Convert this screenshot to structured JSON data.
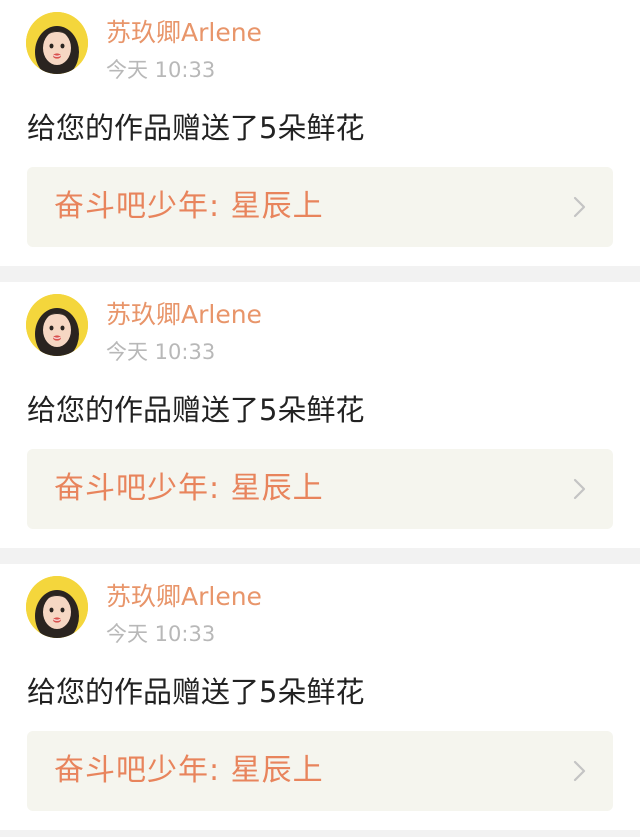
{
  "notifications": [
    {
      "username": "苏玖卿Arlene",
      "timestamp": "今天 10:33",
      "message": "给您的作品赠送了5朵鲜花",
      "link_title": "奋斗吧少年: 星辰上",
      "avatar_icon": "user-avatar",
      "chevron_icon": "chevron-right-icon"
    },
    {
      "username": "苏玖卿Arlene",
      "timestamp": "今天 10:33",
      "message": "给您的作品赠送了5朵鲜花",
      "link_title": "奋斗吧少年: 星辰上",
      "avatar_icon": "user-avatar",
      "chevron_icon": "chevron-right-icon"
    },
    {
      "username": "苏玖卿Arlene",
      "timestamp": "今天 10:33",
      "message": "给您的作品赠送了5朵鲜花",
      "link_title": "奋斗吧少年: 星辰上",
      "avatar_icon": "user-avatar",
      "chevron_icon": "chevron-right-icon"
    }
  ],
  "colors": {
    "username": "#e8956a",
    "link_title": "#e8845c",
    "timestamp": "#b8b8b8",
    "message": "#222222",
    "link_background": "#f5f5ee",
    "page_background": "#f2f2f2"
  }
}
